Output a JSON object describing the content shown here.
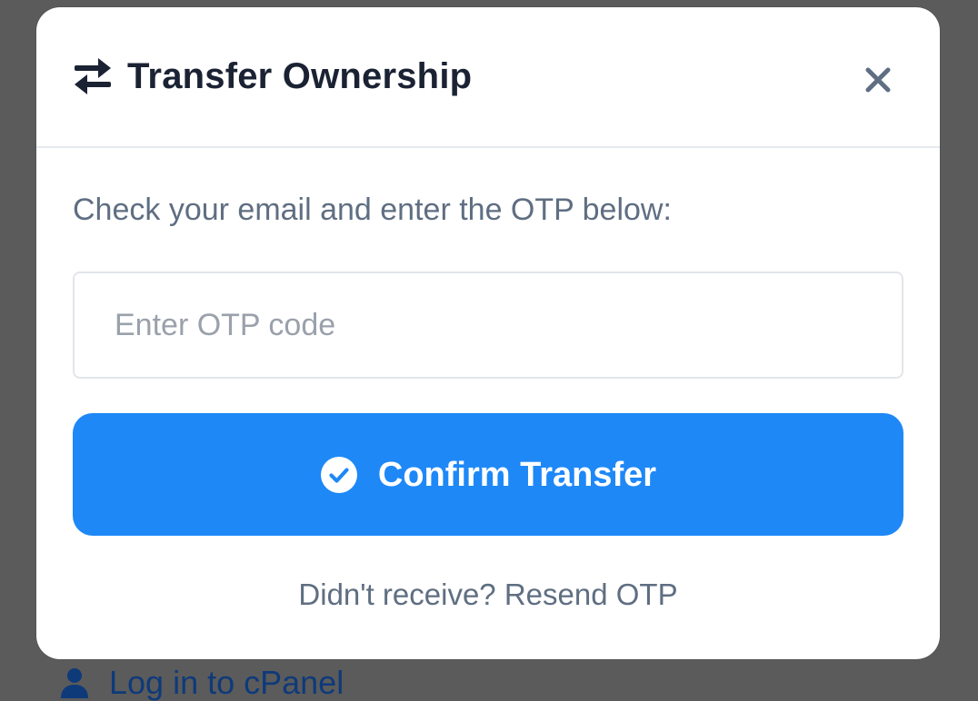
{
  "background": {
    "link_label": "Log in to cPanel",
    "link_icon": "user-icon"
  },
  "modal": {
    "title": "Transfer Ownership",
    "title_icon": "transfer-arrows-icon",
    "close_icon": "close-icon",
    "instruction": "Check your email and enter the OTP below:",
    "otp_input": {
      "placeholder": "Enter OTP code",
      "value": ""
    },
    "confirm_button": {
      "label": "Confirm Transfer",
      "icon": "check-circle-icon"
    },
    "resend": {
      "prefix": "Didn't receive?",
      "link_label": "Resend OTP"
    }
  },
  "colors": {
    "overlay": "#5b5b5b",
    "primary": "#1e88f7",
    "title_text": "#1a2233",
    "muted_text": "#5f6e82",
    "link_text": "#0e3a7a"
  }
}
